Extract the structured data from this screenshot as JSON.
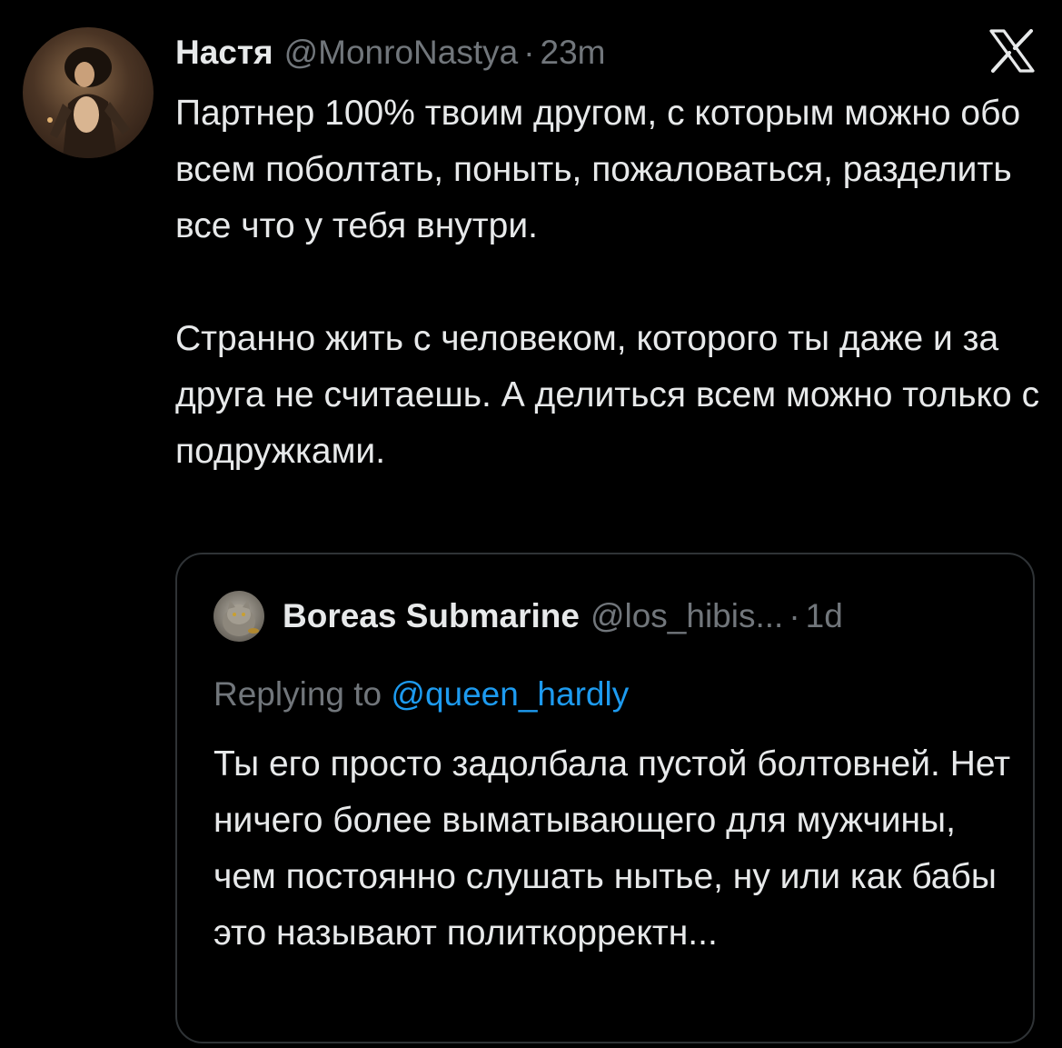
{
  "tweet": {
    "author_name": "Настя",
    "author_handle": "@MonroNastya",
    "separator": "·",
    "time": "23m",
    "paragraph_1": "Партнер 100% твоим другом, с которым можно обо всем поболтать, поныть, пожаловаться, разделить все что у тебя внутри.",
    "paragraph_2": "Странно жить с человеком, которого ты даже и за друга не считаешь. А делиться всем можно только с подружками."
  },
  "quoted_tweet": {
    "author_name": "Boreas Submarine",
    "author_handle": "@los_hibis...",
    "separator": "·",
    "time": "1d",
    "replying_prefix": "Replying to",
    "replying_handle": "@queen_hardly",
    "text": "Ты его просто задолбала пустой болтовней. Нет ничего более выматывающего для мужчины, чем постоянно слушать нытье, ну или как бабы это называют политкорректн..."
  },
  "icons": {
    "platform_logo": "x-logo-icon"
  },
  "colors": {
    "background": "#000000",
    "primary_text": "#e7e9ea",
    "secondary_text": "#71767b",
    "link": "#1d9bf0",
    "border": "#2f3336"
  }
}
